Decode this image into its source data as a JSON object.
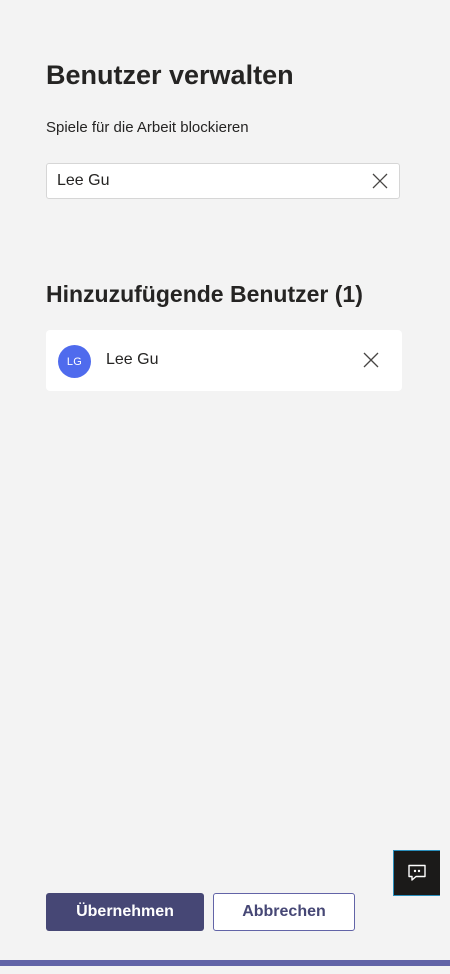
{
  "header": {
    "title": "Benutzer verwalten",
    "subtitle": "Spiele für die Arbeit blockieren"
  },
  "search": {
    "value": "Lee Gu",
    "clear_icon": "close-icon"
  },
  "users_section": {
    "title": "Hinzuzufügende Benutzer (1)",
    "users": [
      {
        "initials": "LG",
        "name": "Lee Gu",
        "avatar_color": "#4f6bed",
        "remove_icon": "close-icon"
      }
    ]
  },
  "feedback": {
    "icon": "chat-feedback-icon"
  },
  "footer": {
    "apply_label": "Übernehmen",
    "cancel_label": "Abbrechen"
  },
  "colors": {
    "background": "#f3f3f3",
    "accent": "#464775",
    "accent_light": "#6264a7",
    "avatar": "#4f6bed"
  }
}
